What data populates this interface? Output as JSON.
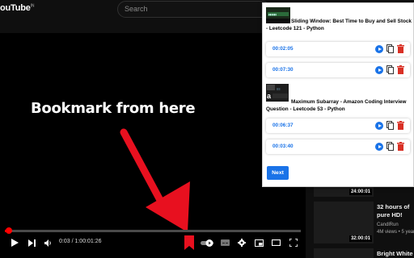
{
  "youtube": {
    "logo_text": "ouTube",
    "logo_sup": "IN",
    "search_placeholder": "Search"
  },
  "player": {
    "overlay_text": "Bookmark from here",
    "time": "0:03 / 1:00:01:26",
    "progress": 0.0008
  },
  "recommendations": [
    {
      "duration": "24:00:01",
      "title": "",
      "channel": "",
      "meta": ""
    },
    {
      "duration": "32:00:01",
      "title": "32 hours of pure HD!",
      "channel": "CandlRun",
      "meta": "4M views  •  5 years"
    },
    {
      "duration": "",
      "title": "Bright White Nig",
      "channel": "",
      "meta": ""
    }
  ],
  "popup": {
    "videos": [
      {
        "title": "Sliding Window: Best Time to Buy and Sell Stock - Leetcode 121 - Python",
        "bookmarks": [
          "00:02:05",
          "00:07:30"
        ]
      },
      {
        "title": "Maximum Subarray - Amazon Coding Interview Question - Leetcode 53 - Python",
        "bookmarks": [
          "00:06:37",
          "00:03:40"
        ]
      }
    ],
    "next_label": "Next"
  },
  "colors": {
    "accent_blue": "#1a73e8",
    "delete_red": "#d93025",
    "arrow_red": "#e8101f",
    "progress_red": "#ff0000"
  },
  "icons": [
    "play-icon",
    "skip-next-icon",
    "volume-icon",
    "bookmark-icon",
    "autoplay-toggle-icon",
    "subtitles-icon",
    "settings-icon",
    "miniplayer-icon",
    "theater-icon",
    "fullscreen-icon",
    "copy-icon",
    "delete-icon"
  ]
}
